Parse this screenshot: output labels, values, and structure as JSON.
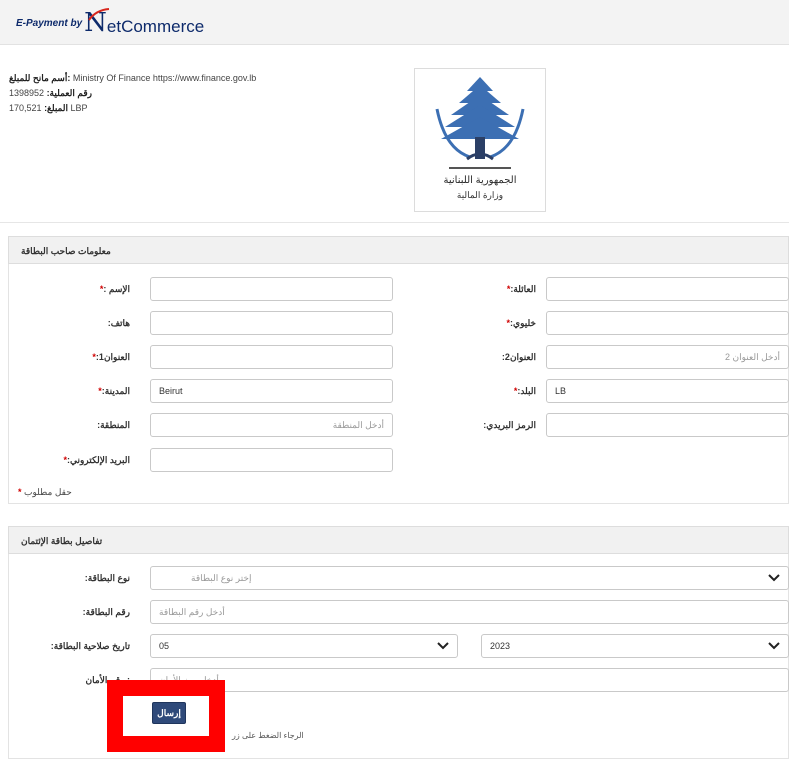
{
  "header": {
    "brand_prefix": "E-Payment by",
    "brand_initial": "N",
    "brand_rest": "etCommerce"
  },
  "merchant": {
    "line1_label": "أسم مانح للمبلغ:",
    "line1_value": "Ministry Of Finance https://www.finance.gov.lb",
    "line2_label": "رقم العملية:",
    "line2_value": "1398952",
    "line3_label": "المبلغ:",
    "line3_value": "170,521 LBP",
    "logo_text1": "الجمهورية اللبنانية",
    "logo_text2": "وزارة المالية"
  },
  "cardholder": {
    "title": "معلومات صاحب البطاقة",
    "name_label": ": الإسم",
    "family_label": ":العائلة",
    "phone_label": ":هاتف",
    "mobile_label": ":خليوي",
    "address1_label": ":العنوان1",
    "address2_label": ":العنوان2",
    "address2_placeholder": "أدخل العنوان 2",
    "city_label": ":المدينة",
    "city_value": "Beirut",
    "country_label": ":البلد",
    "country_value": "LB",
    "region_label": ":المنطقة",
    "region_placeholder": "أدخل المنطقة",
    "zip_label": ":الرمز البريدي",
    "email_label": ":البريد الإلكتروني",
    "required_note": "حقل مطلوب",
    "required_mark": "*"
  },
  "card": {
    "title": "تفاصيل بطاقة الإئتمان",
    "type_label": ":نوع البطاقة",
    "type_placeholder": "إختر نوع البطاقة",
    "number_label": ":رقم البطاقة",
    "number_placeholder": "أدخل رقم البطاقة",
    "expiry_label": ":تاريخ صلاحية البطاقة",
    "expiry_month": "05",
    "expiry_year": "2023",
    "cvv_label": "رقم الأمان :",
    "cvv_placeholder": "أدخل رمز الأمان"
  },
  "actions": {
    "submit_label": "إرسال",
    "bottom_note": "الرجاء الضغط على زر"
  },
  "colors": {
    "brand": "#0d2a6b",
    "button": "#2f4a7a",
    "required": "#d00000",
    "highlight": "#ff0000"
  }
}
